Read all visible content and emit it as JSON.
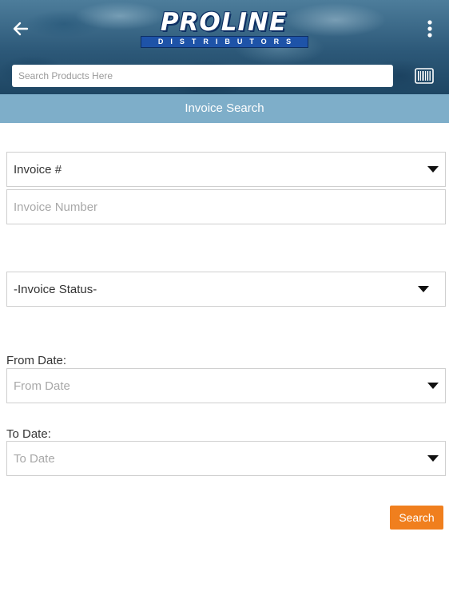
{
  "header": {
    "logo_main": "PROLINE",
    "logo_sub": "DISTRIBUTORS",
    "back_icon": "arrow-left-icon",
    "menu_icon": "more-vertical-icon",
    "barcode_icon": "barcode-icon"
  },
  "search": {
    "placeholder": "Search Products Here",
    "value": ""
  },
  "page": {
    "title": "Invoice Search"
  },
  "form": {
    "search_by": {
      "selected": "Invoice #"
    },
    "invoice_number": {
      "placeholder": "Invoice Number",
      "value": ""
    },
    "invoice_status": {
      "selected": "-Invoice Status-"
    },
    "from_date": {
      "label": "From Date:",
      "placeholder": "From Date"
    },
    "to_date": {
      "label": "To Date:",
      "placeholder": "To Date"
    },
    "search_button": "Search"
  },
  "colors": {
    "title_bar": "#7eaec9",
    "search_button": "#f07f1e",
    "header_dark": "#1e4663"
  }
}
